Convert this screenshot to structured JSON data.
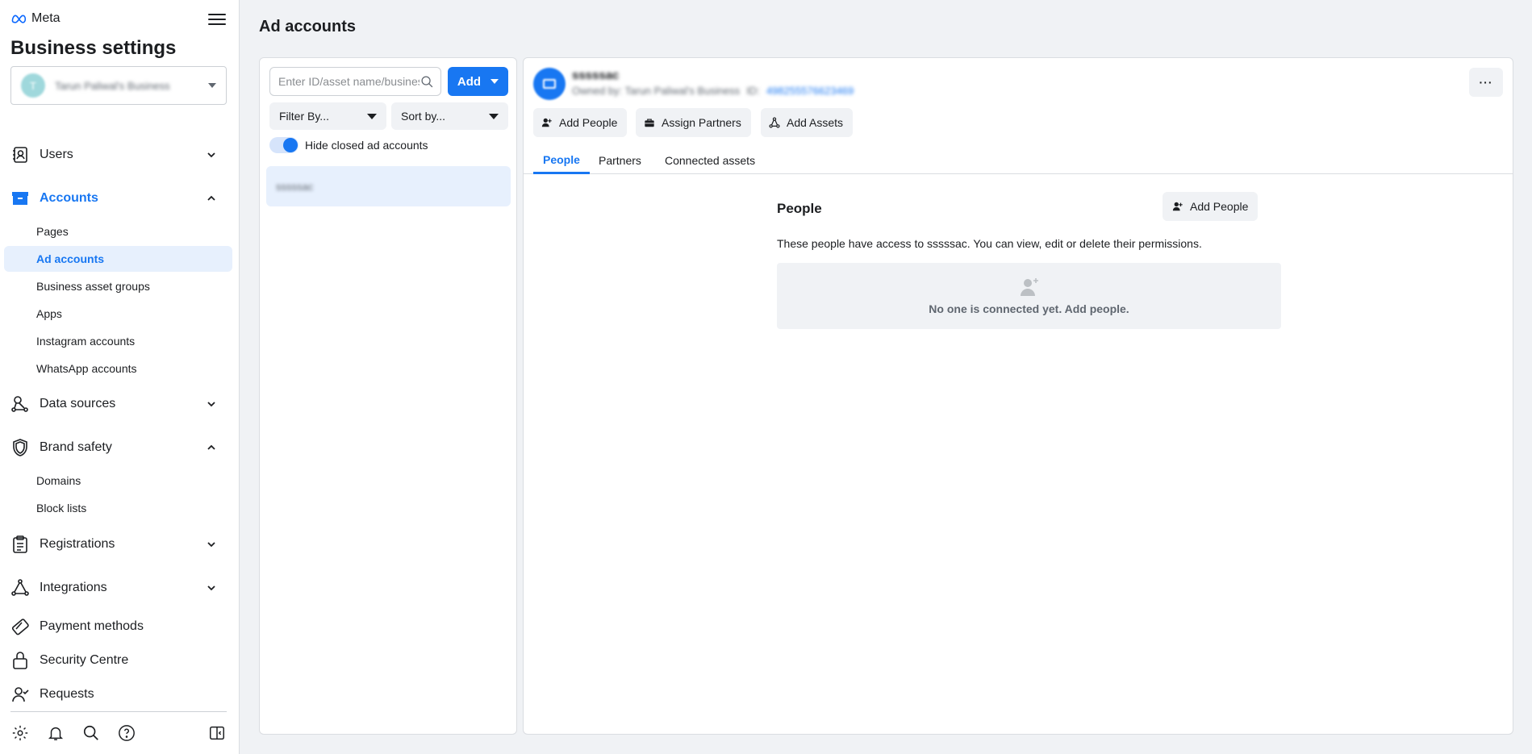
{
  "brand": {
    "name": "Meta"
  },
  "sidebar": {
    "title": "Business settings",
    "business": {
      "initial": "T",
      "name": "Tarun Paliwal's Business"
    },
    "items": [
      {
        "key": "users",
        "label": "Users",
        "icon": "users-icon"
      },
      {
        "key": "accounts",
        "label": "Accounts",
        "icon": "accounts-icon"
      },
      {
        "key": "data-sources",
        "label": "Data sources",
        "icon": "data-sources-icon"
      },
      {
        "key": "brand-safety",
        "label": "Brand safety",
        "icon": "shield-icon"
      },
      {
        "key": "registrations",
        "label": "Registrations",
        "icon": "clipboard-icon"
      },
      {
        "key": "integrations",
        "label": "Integrations",
        "icon": "integrations-icon"
      },
      {
        "key": "payment-methods",
        "label": "Payment methods",
        "icon": "card-icon"
      },
      {
        "key": "security-centre",
        "label": "Security Centre",
        "icon": "lock-icon"
      },
      {
        "key": "requests",
        "label": "Requests",
        "icon": "requests-icon"
      }
    ],
    "accounts_sub": [
      "Pages",
      "Ad accounts",
      "Business asset groups",
      "Apps",
      "Instagram accounts",
      "WhatsApp accounts"
    ],
    "brand_safety_sub": [
      "Domains",
      "Block lists"
    ]
  },
  "main": {
    "title": "Ad accounts",
    "list": {
      "search_placeholder": "Enter ID/asset name/business name",
      "add_label": "Add",
      "filter_label": "Filter By...",
      "sort_label": "Sort by...",
      "toggle_label": "Hide closed ad accounts",
      "toggle_on": true,
      "items": [
        "sssssac"
      ]
    },
    "detail": {
      "account_name": "sssssac",
      "owned_by": "Owned by: Tarun Paliwal's Business",
      "id_label": "ID:",
      "id_value": "498255576623469",
      "more_label": "···",
      "actions": [
        "Add People",
        "Assign Partners",
        "Add Assets"
      ],
      "tabs": [
        "People",
        "Partners",
        "Connected assets"
      ],
      "active_tab": "People",
      "people": {
        "title": "People",
        "add_label": "Add People",
        "description": "These people have access to sssssac. You can view, edit or delete their permissions.",
        "empty_text": "No one is connected yet. Add people."
      }
    }
  },
  "colors": {
    "accent": "#1877f2",
    "active_bg": "#e7f0fd",
    "page_bg": "#f0f2f5"
  }
}
